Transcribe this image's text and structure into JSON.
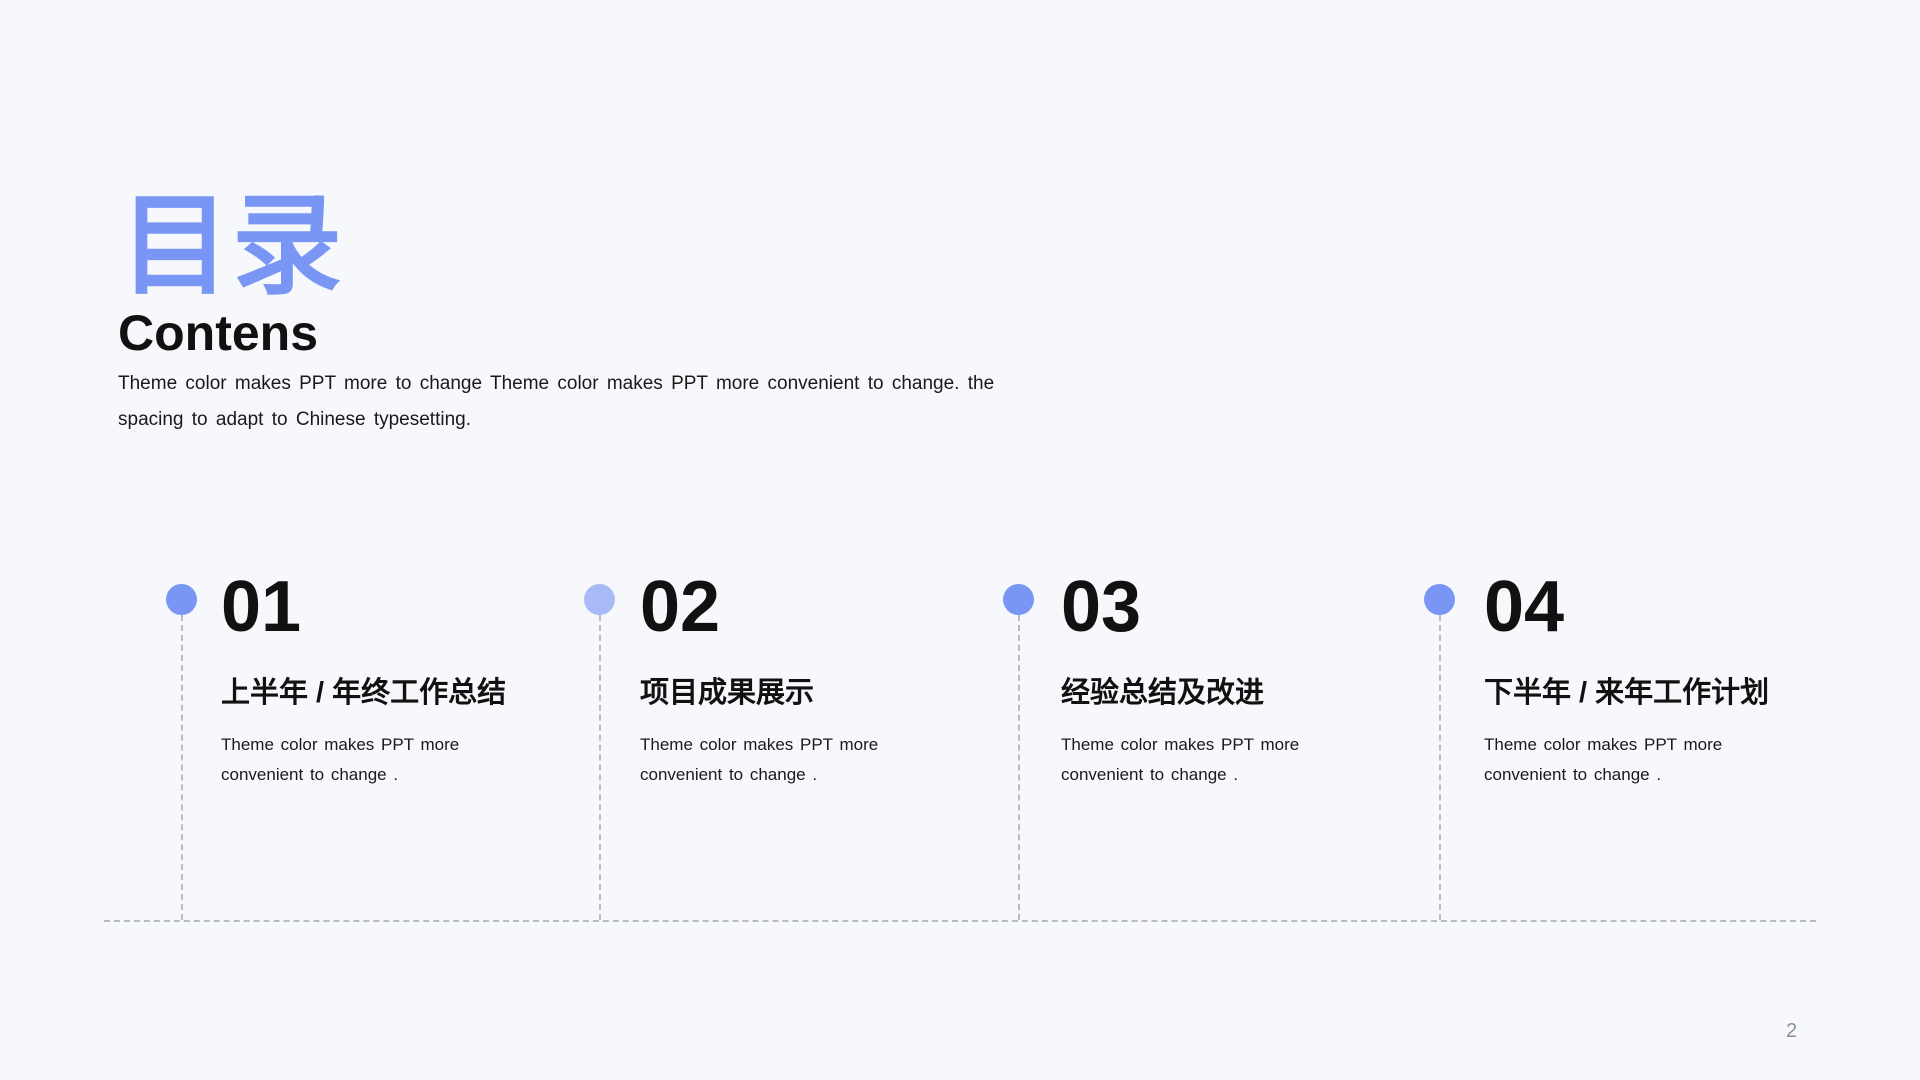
{
  "slide": {
    "title_cn": "目录",
    "title_en": "Contens",
    "intro": "Theme  color makes PPT more to change Theme  color makes PPT more convenient  to change. the spacing  to adapt to Chinese  typesetting.",
    "page_number": "2",
    "accent_color": "#7a96f5",
    "accent_light_color": "#a9bbf7"
  },
  "items": [
    {
      "number": "01",
      "heading": "上半年 / 年终工作总结",
      "desc": "Theme  color makes PPT more convenient to change ."
    },
    {
      "number": "02",
      "heading": "项目成果展示",
      "desc": "Theme  color makes PPT more convenient to change ."
    },
    {
      "number": "03",
      "heading": "经验总结及改进",
      "desc": "Theme  color makes PPT more convenient to change ."
    },
    {
      "number": "04",
      "heading": "下半年 / 来年工作计划",
      "desc": "Theme  color makes PPT more convenient to change ."
    }
  ]
}
